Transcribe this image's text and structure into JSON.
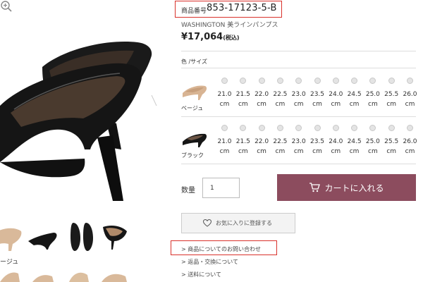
{
  "product": {
    "code_label": "商品番号",
    "code": "853-17123-5-B",
    "name": "WASHINGTON 美ラインパンプス",
    "price": "¥17,064",
    "price_tax": "(税込)"
  },
  "options": {
    "label": "色 /サイズ",
    "unit": "cm",
    "sizes": [
      "21.0",
      "21.5",
      "22.0",
      "22.5",
      "23.0",
      "23.5",
      "24.0",
      "24.5",
      "25.0",
      "25.5",
      "26.0"
    ],
    "colors": [
      {
        "name": "ベージュ"
      },
      {
        "name": "ブラック"
      }
    ]
  },
  "purchase": {
    "qty_label": "数量",
    "qty_value": "1",
    "cart_label": "カートに入れる",
    "favorite_label": "お気に入りに登録する"
  },
  "links": {
    "inquiry": "> 商品についてのお問い合わせ",
    "returns": "> 返品・交換について",
    "shipping": "> 送料について"
  },
  "gallery": {
    "thumb_label": "ージュ"
  },
  "colors": {
    "accent": "#8c4c5e",
    "highlight_border": "#d9312b"
  },
  "icons": {
    "zoom": "zoom-icon",
    "cart": "cart-icon",
    "heart": "heart-icon"
  }
}
